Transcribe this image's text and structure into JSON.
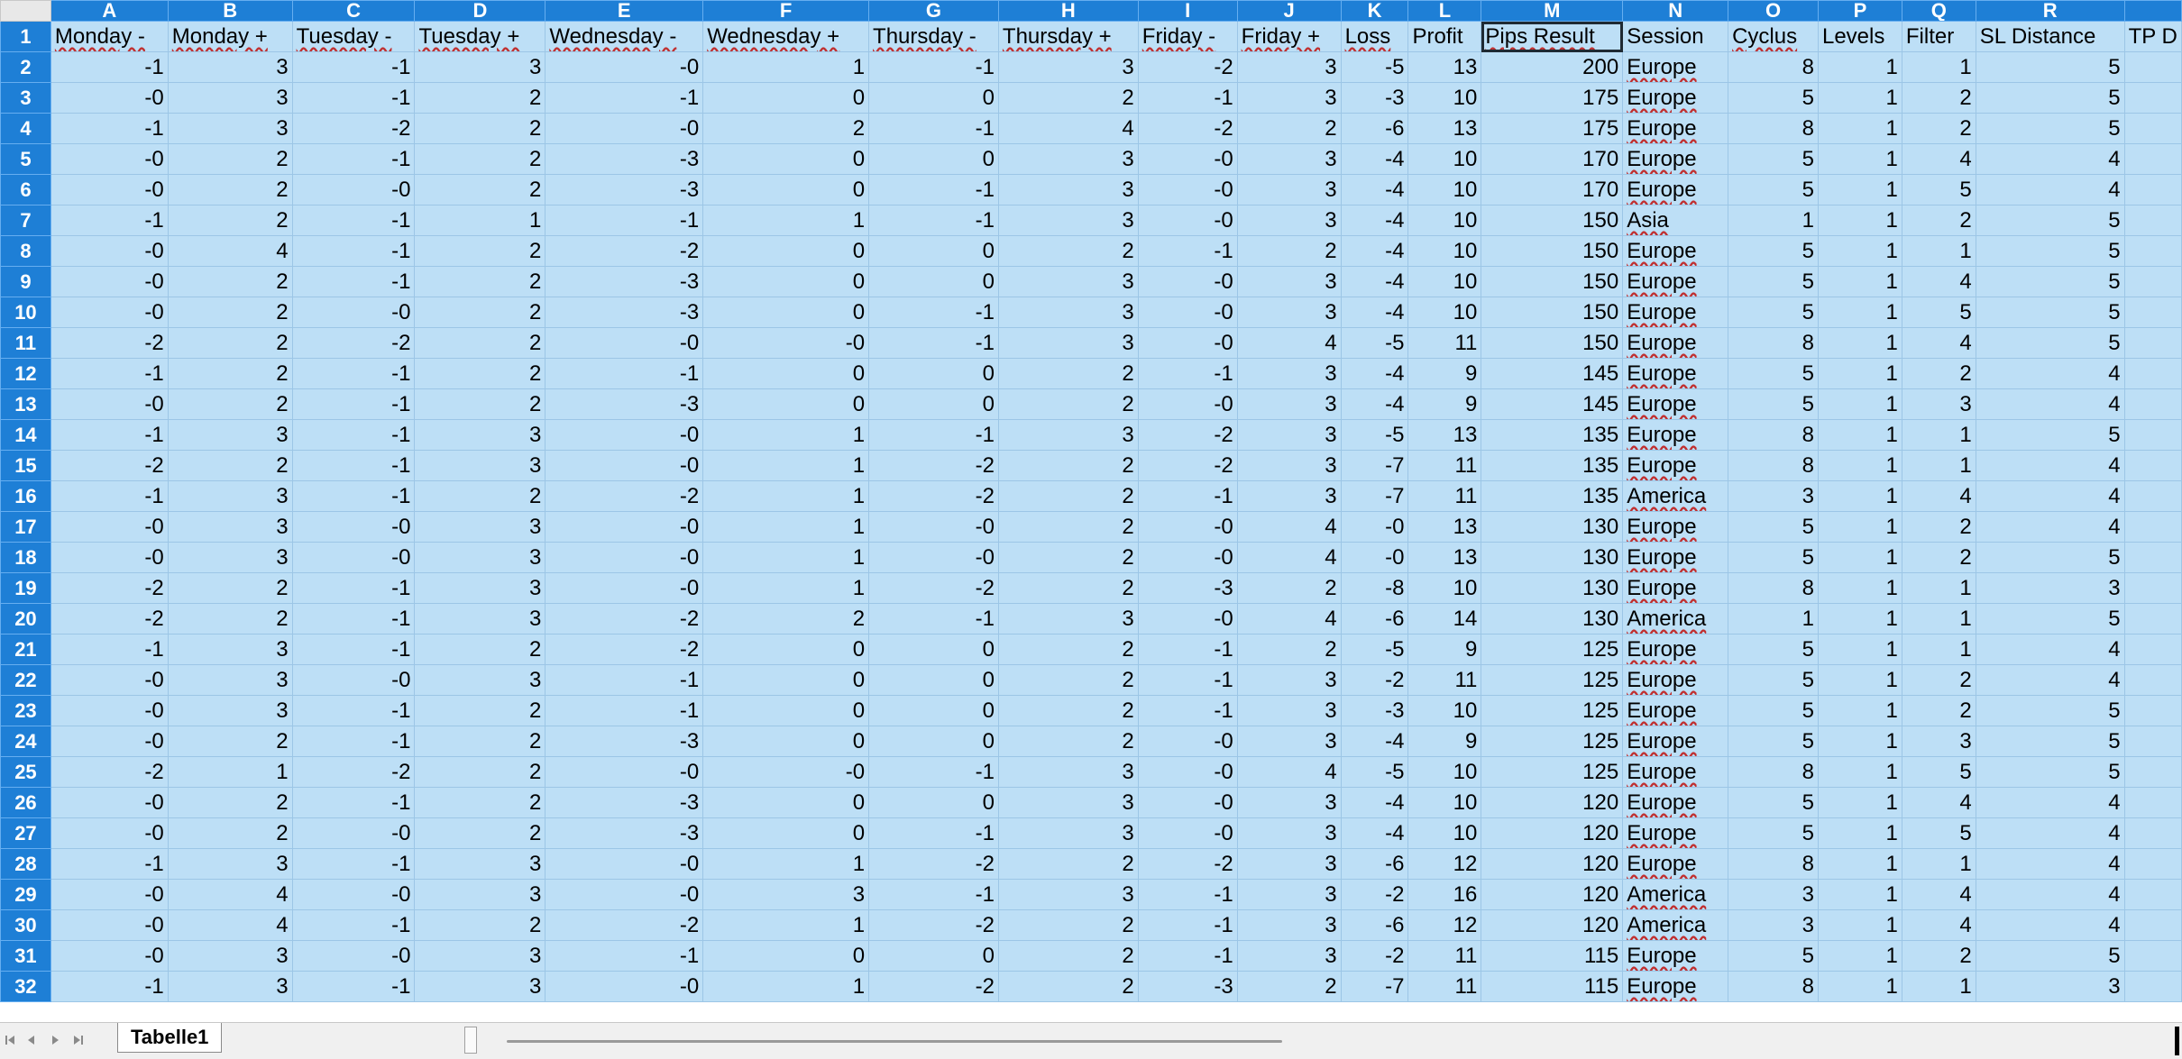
{
  "sheet": {
    "tab_name": "Tabelle1",
    "active_cell": "M1",
    "column_letters": [
      "A",
      "B",
      "C",
      "D",
      "E",
      "F",
      "G",
      "H",
      "I",
      "J",
      "K",
      "L",
      "M",
      "N",
      "O",
      "P",
      "Q",
      "R",
      ""
    ],
    "header_row": [
      "Monday -",
      "Monday +",
      "Tuesday -",
      "Tuesday +",
      "Wednesday -",
      "Wednesday +",
      "Thursday -",
      "Thursday +",
      "Friday -",
      "Friday +",
      "Loss",
      "Profit",
      "Pips Result",
      "Session",
      "Cyclus",
      "Levels",
      "Filter",
      "SL Distance",
      "TP D"
    ],
    "rows": [
      {
        "n": "2",
        "c": [
          "-1",
          "3",
          "-1",
          "3",
          "-0",
          "1",
          "-1",
          "3",
          "-2",
          "3",
          "-5",
          "13",
          "200",
          "Europe",
          "8",
          "1",
          "1",
          "5"
        ]
      },
      {
        "n": "3",
        "c": [
          "-0",
          "3",
          "-1",
          "2",
          "-1",
          "0",
          "0",
          "2",
          "-1",
          "3",
          "-3",
          "10",
          "175",
          "Europe",
          "5",
          "1",
          "2",
          "5"
        ]
      },
      {
        "n": "4",
        "c": [
          "-1",
          "3",
          "-2",
          "2",
          "-0",
          "2",
          "-1",
          "4",
          "-2",
          "2",
          "-6",
          "13",
          "175",
          "Europe",
          "8",
          "1",
          "2",
          "5"
        ]
      },
      {
        "n": "5",
        "c": [
          "-0",
          "2",
          "-1",
          "2",
          "-3",
          "0",
          "0",
          "3",
          "-0",
          "3",
          "-4",
          "10",
          "170",
          "Europe",
          "5",
          "1",
          "4",
          "4"
        ]
      },
      {
        "n": "6",
        "c": [
          "-0",
          "2",
          "-0",
          "2",
          "-3",
          "0",
          "-1",
          "3",
          "-0",
          "3",
          "-4",
          "10",
          "170",
          "Europe",
          "5",
          "1",
          "5",
          "4"
        ]
      },
      {
        "n": "7",
        "c": [
          "-1",
          "2",
          "-1",
          "1",
          "-1",
          "1",
          "-1",
          "3",
          "-0",
          "3",
          "-4",
          "10",
          "150",
          "Asia",
          "1",
          "1",
          "2",
          "5"
        ]
      },
      {
        "n": "8",
        "c": [
          "-0",
          "4",
          "-1",
          "2",
          "-2",
          "0",
          "0",
          "2",
          "-1",
          "2",
          "-4",
          "10",
          "150",
          "Europe",
          "5",
          "1",
          "1",
          "5"
        ]
      },
      {
        "n": "9",
        "c": [
          "-0",
          "2",
          "-1",
          "2",
          "-3",
          "0",
          "0",
          "3",
          "-0",
          "3",
          "-4",
          "10",
          "150",
          "Europe",
          "5",
          "1",
          "4",
          "5"
        ]
      },
      {
        "n": "10",
        "c": [
          "-0",
          "2",
          "-0",
          "2",
          "-3",
          "0",
          "-1",
          "3",
          "-0",
          "3",
          "-4",
          "10",
          "150",
          "Europe",
          "5",
          "1",
          "5",
          "5"
        ]
      },
      {
        "n": "11",
        "c": [
          "-2",
          "2",
          "-2",
          "2",
          "-0",
          "-0",
          "-1",
          "3",
          "-0",
          "4",
          "-5",
          "11",
          "150",
          "Europe",
          "8",
          "1",
          "4",
          "5"
        ]
      },
      {
        "n": "12",
        "c": [
          "-1",
          "2",
          "-1",
          "2",
          "-1",
          "0",
          "0",
          "2",
          "-1",
          "3",
          "-4",
          "9",
          "145",
          "Europe",
          "5",
          "1",
          "2",
          "4"
        ]
      },
      {
        "n": "13",
        "c": [
          "-0",
          "2",
          "-1",
          "2",
          "-3",
          "0",
          "0",
          "2",
          "-0",
          "3",
          "-4",
          "9",
          "145",
          "Europe",
          "5",
          "1",
          "3",
          "4"
        ]
      },
      {
        "n": "14",
        "c": [
          "-1",
          "3",
          "-1",
          "3",
          "-0",
          "1",
          "-1",
          "3",
          "-2",
          "3",
          "-5",
          "13",
          "135",
          "Europe",
          "8",
          "1",
          "1",
          "5"
        ]
      },
      {
        "n": "15",
        "c": [
          "-2",
          "2",
          "-1",
          "3",
          "-0",
          "1",
          "-2",
          "2",
          "-2",
          "3",
          "-7",
          "11",
          "135",
          "Europe",
          "8",
          "1",
          "1",
          "4"
        ]
      },
      {
        "n": "16",
        "c": [
          "-1",
          "3",
          "-1",
          "2",
          "-2",
          "1",
          "-2",
          "2",
          "-1",
          "3",
          "-7",
          "11",
          "135",
          "America",
          "3",
          "1",
          "4",
          "4"
        ]
      },
      {
        "n": "17",
        "c": [
          "-0",
          "3",
          "-0",
          "3",
          "-0",
          "1",
          "-0",
          "2",
          "-0",
          "4",
          "-0",
          "13",
          "130",
          "Europe",
          "5",
          "1",
          "2",
          "4"
        ]
      },
      {
        "n": "18",
        "c": [
          "-0",
          "3",
          "-0",
          "3",
          "-0",
          "1",
          "-0",
          "2",
          "-0",
          "4",
          "-0",
          "13",
          "130",
          "Europe",
          "5",
          "1",
          "2",
          "5"
        ]
      },
      {
        "n": "19",
        "c": [
          "-2",
          "2",
          "-1",
          "3",
          "-0",
          "1",
          "-2",
          "2",
          "-3",
          "2",
          "-8",
          "10",
          "130",
          "Europe",
          "8",
          "1",
          "1",
          "3"
        ]
      },
      {
        "n": "20",
        "c": [
          "-2",
          "2",
          "-1",
          "3",
          "-2",
          "2",
          "-1",
          "3",
          "-0",
          "4",
          "-6",
          "14",
          "130",
          "America",
          "1",
          "1",
          "1",
          "5"
        ]
      },
      {
        "n": "21",
        "c": [
          "-1",
          "3",
          "-1",
          "2",
          "-2",
          "0",
          "0",
          "2",
          "-1",
          "2",
          "-5",
          "9",
          "125",
          "Europe",
          "5",
          "1",
          "1",
          "4"
        ]
      },
      {
        "n": "22",
        "c": [
          "-0",
          "3",
          "-0",
          "3",
          "-1",
          "0",
          "0",
          "2",
          "-1",
          "3",
          "-2",
          "11",
          "125",
          "Europe",
          "5",
          "1",
          "2",
          "4"
        ]
      },
      {
        "n": "23",
        "c": [
          "-0",
          "3",
          "-1",
          "2",
          "-1",
          "0",
          "0",
          "2",
          "-1",
          "3",
          "-3",
          "10",
          "125",
          "Europe",
          "5",
          "1",
          "2",
          "5"
        ]
      },
      {
        "n": "24",
        "c": [
          "-0",
          "2",
          "-1",
          "2",
          "-3",
          "0",
          "0",
          "2",
          "-0",
          "3",
          "-4",
          "9",
          "125",
          "Europe",
          "5",
          "1",
          "3",
          "5"
        ]
      },
      {
        "n": "25",
        "c": [
          "-2",
          "1",
          "-2",
          "2",
          "-0",
          "-0",
          "-1",
          "3",
          "-0",
          "4",
          "-5",
          "10",
          "125",
          "Europe",
          "8",
          "1",
          "5",
          "5"
        ]
      },
      {
        "n": "26",
        "c": [
          "-0",
          "2",
          "-1",
          "2",
          "-3",
          "0",
          "0",
          "3",
          "-0",
          "3",
          "-4",
          "10",
          "120",
          "Europe",
          "5",
          "1",
          "4",
          "4"
        ]
      },
      {
        "n": "27",
        "c": [
          "-0",
          "2",
          "-0",
          "2",
          "-3",
          "0",
          "-1",
          "3",
          "-0",
          "3",
          "-4",
          "10",
          "120",
          "Europe",
          "5",
          "1",
          "5",
          "4"
        ]
      },
      {
        "n": "28",
        "c": [
          "-1",
          "3",
          "-1",
          "3",
          "-0",
          "1",
          "-2",
          "2",
          "-2",
          "3",
          "-6",
          "12",
          "120",
          "Europe",
          "8",
          "1",
          "1",
          "4"
        ]
      },
      {
        "n": "29",
        "c": [
          "-0",
          "4",
          "-0",
          "3",
          "-0",
          "3",
          "-1",
          "3",
          "-1",
          "3",
          "-2",
          "16",
          "120",
          "America",
          "3",
          "1",
          "4",
          "4"
        ]
      },
      {
        "n": "30",
        "c": [
          "-0",
          "4",
          "-1",
          "2",
          "-2",
          "1",
          "-2",
          "2",
          "-1",
          "3",
          "-6",
          "12",
          "120",
          "America",
          "3",
          "1",
          "4",
          "4"
        ]
      },
      {
        "n": "31",
        "c": [
          "-0",
          "3",
          "-0",
          "3",
          "-1",
          "0",
          "0",
          "2",
          "-1",
          "3",
          "-2",
          "11",
          "115",
          "Europe",
          "5",
          "1",
          "2",
          "5"
        ]
      },
      {
        "n": "32",
        "c": [
          "-1",
          "3",
          "-1",
          "3",
          "-0",
          "1",
          "-2",
          "2",
          "-3",
          "2",
          "-7",
          "11",
          "115",
          "Europe",
          "8",
          "1",
          "1",
          "3"
        ]
      }
    ]
  }
}
